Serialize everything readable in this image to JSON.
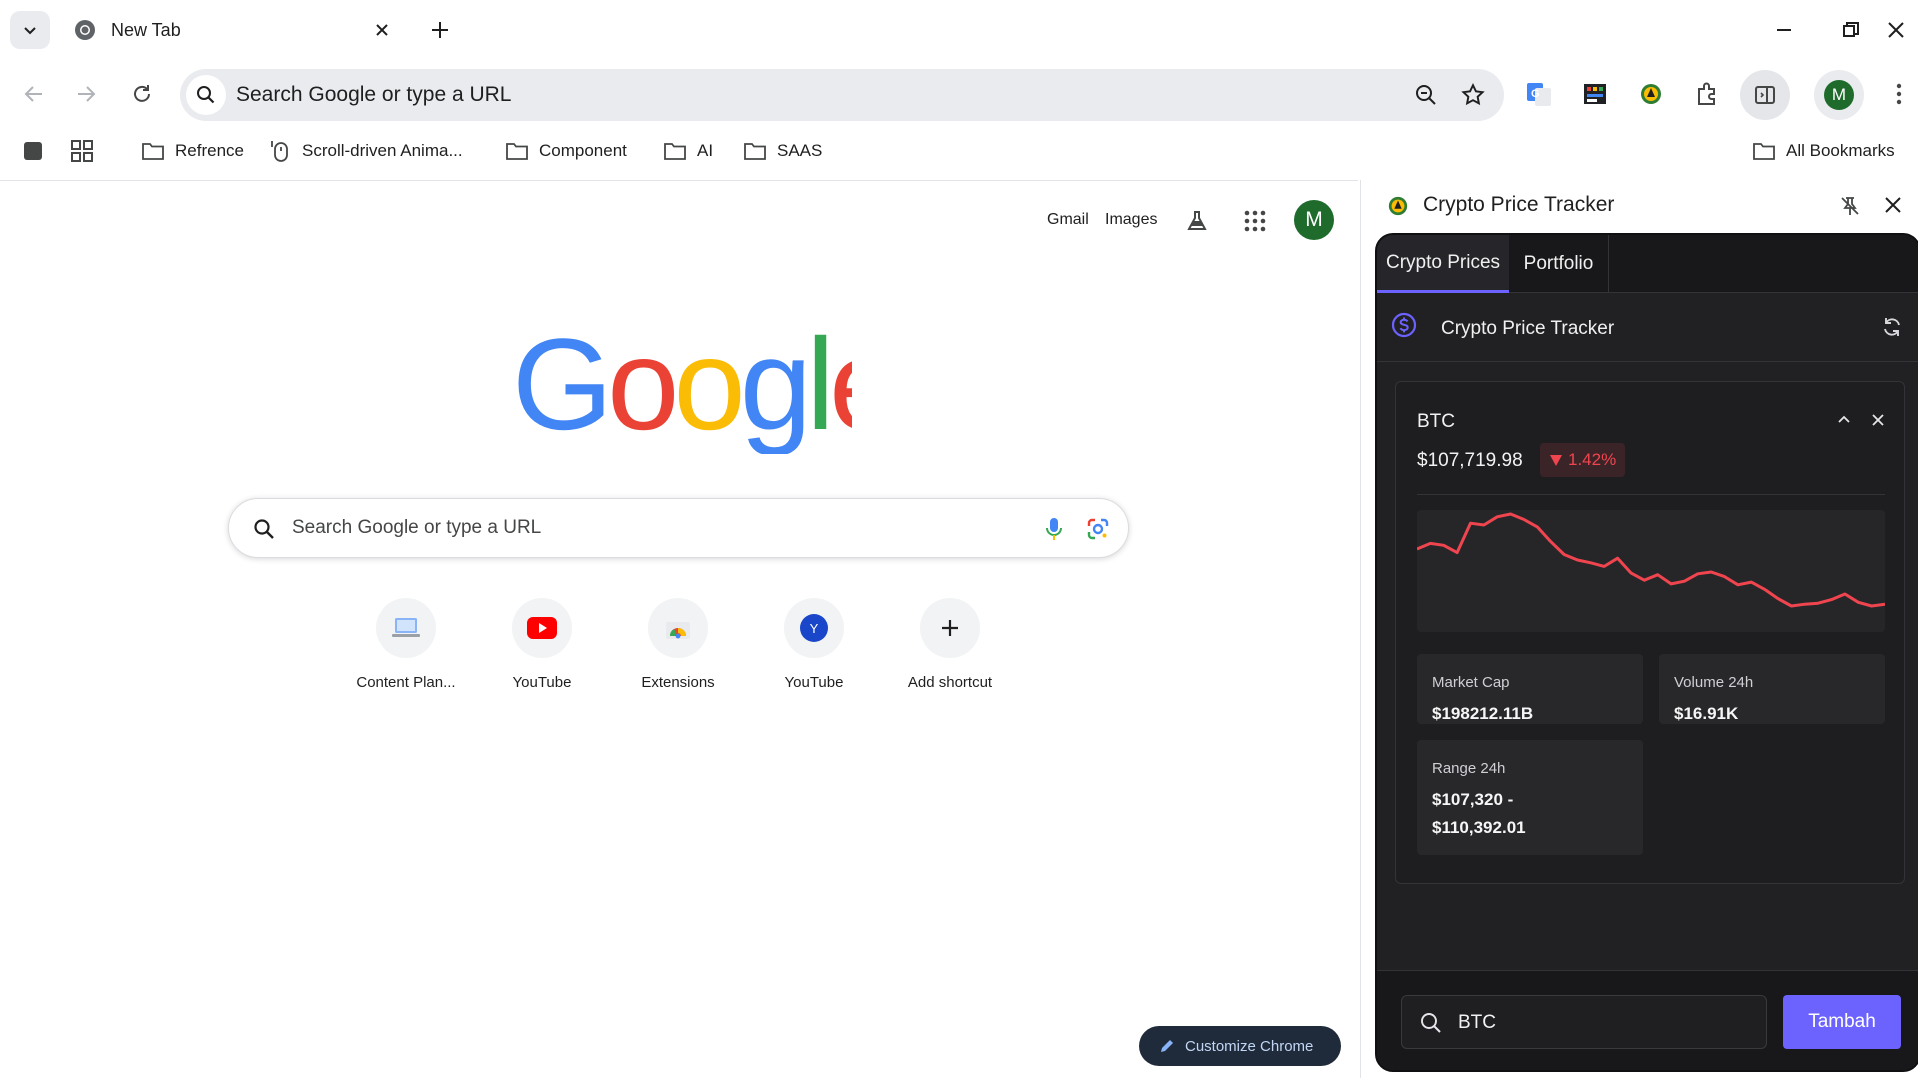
{
  "browser": {
    "tab_title": "New Tab",
    "omnibox_placeholder": "Search Google or type a URL",
    "profile_initial": "M"
  },
  "bookmarks": {
    "items": [
      {
        "label": "Refrence"
      },
      {
        "label": "Scroll-driven Anima..."
      },
      {
        "label": "Component"
      },
      {
        "label": "AI"
      },
      {
        "label": "SAAS"
      }
    ],
    "all_bookmarks": "All Bookmarks"
  },
  "newtab": {
    "top_links": {
      "gmail": "Gmail",
      "images": "Images"
    },
    "profile_initial": "M",
    "search_placeholder": "Search Google or type a URL",
    "shortcuts": [
      {
        "label": "Content Plan..."
      },
      {
        "label": "YouTube"
      },
      {
        "label": "Extensions"
      },
      {
        "label": "YouTube",
        "letter": "Y"
      },
      {
        "label": "Add shortcut"
      }
    ],
    "customize_label": "Customize Chrome"
  },
  "sidepanel": {
    "title": "Crypto Price Tracker",
    "tabs": [
      {
        "label": "Crypto Prices",
        "active": true
      },
      {
        "label": "Portfolio",
        "active": false
      }
    ],
    "app_title": "Crypto Price Tracker",
    "coin": {
      "symbol": "BTC",
      "price": "$107,719.98",
      "change": "1.42%",
      "change_direction": "down",
      "stats": {
        "market_cap_label": "Market Cap",
        "market_cap_value": "$198212.11B",
        "volume_label": "Volume 24h",
        "volume_value": "$16.91K",
        "range_label": "Range 24h",
        "range_value_line1": "$107,320 -",
        "range_value_line2": "$110,392.01"
      },
      "sparkline": [
        0.62,
        0.68,
        0.66,
        0.58,
        0.9,
        0.88,
        0.97,
        1.0,
        0.94,
        0.86,
        0.7,
        0.56,
        0.5,
        0.47,
        0.43,
        0.52,
        0.36,
        0.28,
        0.34,
        0.24,
        0.27,
        0.35,
        0.37,
        0.32,
        0.23,
        0.26,
        0.18,
        0.08,
        0.0,
        0.02,
        0.03,
        0.07,
        0.13,
        0.04,
        0.0,
        0.02
      ]
    },
    "search_value": "BTC",
    "add_button": "Tambah"
  },
  "colors": {
    "accent": "#6c63ff",
    "down": "#f0454f",
    "panel_bg": "#212124"
  }
}
